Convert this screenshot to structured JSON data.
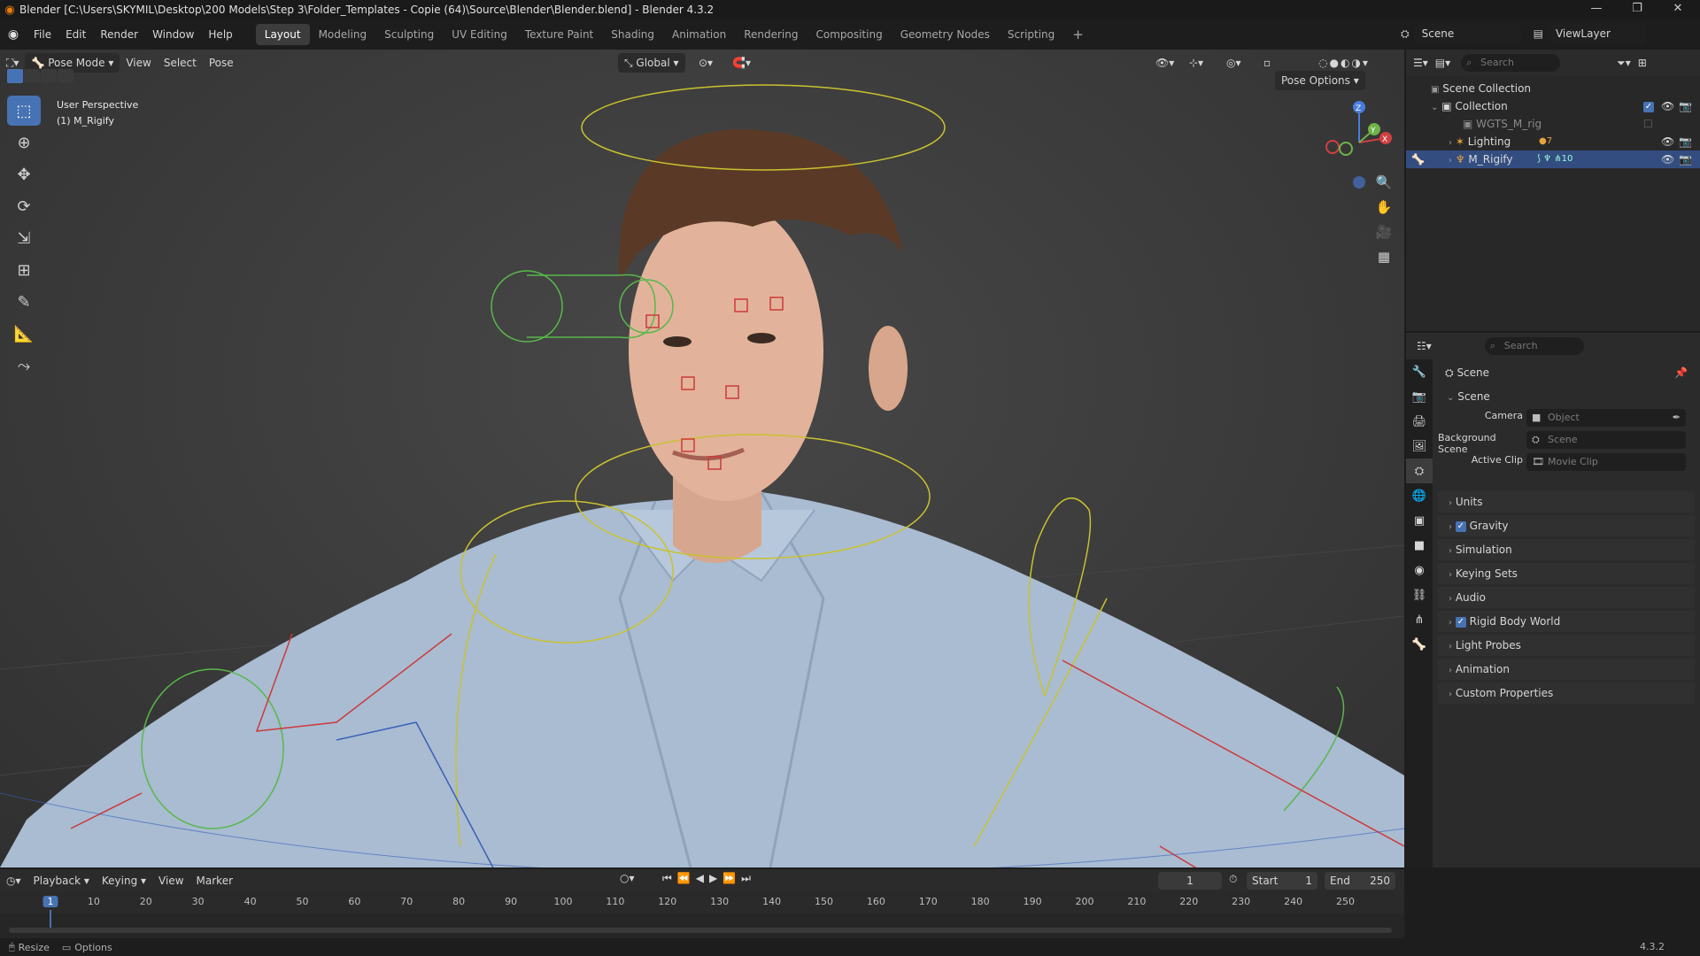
{
  "window": {
    "title": "Blender [C:\\Users\\SKYMIL\\Desktop\\200 Models\\Step 3\\Folder_Templates - Copie (64)\\Source\\Blender\\Blender.blend] - Blender 4.3.2",
    "minimize": "—",
    "maximize": "❐",
    "close": "✕"
  },
  "menubar": {
    "menus": [
      "File",
      "Edit",
      "Render",
      "Window",
      "Help"
    ],
    "workspaces": [
      "Layout",
      "Modeling",
      "Sculpting",
      "UV Editing",
      "Texture Paint",
      "Shading",
      "Animation",
      "Rendering",
      "Compositing",
      "Geometry Nodes",
      "Scripting"
    ],
    "active_workspace": "Layout",
    "add_tab": "+",
    "scene_name": "Scene",
    "view_layer": "ViewLayer"
  },
  "viewport": {
    "mode": "Pose Mode",
    "menus": [
      "View",
      "Select",
      "Pose"
    ],
    "transform_orientation": "Global",
    "pose_options": "Pose Options",
    "overlay_line1": "User Perspective",
    "overlay_line2": "(1) M_Rigify",
    "gizmo_z": "Z",
    "gizmo_x": "X",
    "gizmo_y": "Y"
  },
  "outliner": {
    "search_placeholder": "Search",
    "rows": [
      {
        "label": "Scene Collection"
      },
      {
        "label": "Collection"
      },
      {
        "label": "WGTS_M_rig"
      },
      {
        "label": "Lighting",
        "badge": "7"
      },
      {
        "label": "M_Rigify",
        "badge": "10"
      }
    ]
  },
  "properties": {
    "search_placeholder": "Search",
    "context": "Scene",
    "section": "Scene",
    "fields": [
      {
        "label": "Camera",
        "placeholder": "Object"
      },
      {
        "label": "Background Scene",
        "placeholder": "Scene"
      },
      {
        "label": "Active Clip",
        "placeholder": "Movie Clip"
      }
    ],
    "panels": [
      {
        "label": "Units",
        "checkbox": false
      },
      {
        "label": "Gravity",
        "checkbox": true
      },
      {
        "label": "Simulation",
        "checkbox": false
      },
      {
        "label": "Keying Sets",
        "checkbox": false
      },
      {
        "label": "Audio",
        "checkbox": false
      },
      {
        "label": "Rigid Body World",
        "checkbox": true
      },
      {
        "label": "Light Probes",
        "checkbox": false
      },
      {
        "label": "Animation",
        "checkbox": false
      },
      {
        "label": "Custom Properties",
        "checkbox": false
      }
    ]
  },
  "timeline": {
    "menus": [
      "Playback",
      "Keying",
      "View",
      "Marker"
    ],
    "current_frame": "1",
    "start_label": "Start",
    "start": "1",
    "end_label": "End",
    "end": "250",
    "ticks": [
      "1",
      "10",
      "20",
      "30",
      "40",
      "50",
      "60",
      "70",
      "80",
      "90",
      "100",
      "110",
      "120",
      "130",
      "140",
      "150",
      "160",
      "170",
      "180",
      "190",
      "200",
      "210",
      "220",
      "230",
      "240",
      "250"
    ]
  },
  "statusbar": {
    "resize": "Resize",
    "options": "Options",
    "version": "4.3.2"
  },
  "colors": {
    "accent": "#4772b3",
    "selected_row": "#334d80",
    "blender_orange": "#e87d0d"
  }
}
